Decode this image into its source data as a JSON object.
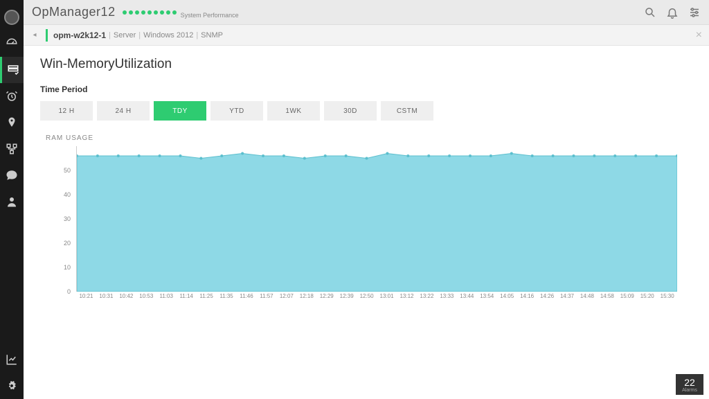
{
  "brand": "OpManager12",
  "system_perf_label": "System Performance",
  "perf_dots": 9,
  "breadcrumb": {
    "host": "opm-w2k12-1",
    "items": [
      "Server",
      "Windows 2012",
      "SNMP"
    ]
  },
  "page_title": "Win-MemoryUtilization",
  "time_period": {
    "label": "Time Period",
    "buttons": [
      "12 H",
      "24 H",
      "TDY",
      "YTD",
      "1WK",
      "30D",
      "CSTM"
    ],
    "active": "TDY"
  },
  "chart_data": {
    "type": "area",
    "title": "RAM USAGE",
    "ylabel": "",
    "xlabel": "",
    "ylim": [
      0,
      60
    ],
    "yticks": [
      0,
      10,
      20,
      30,
      40,
      50
    ],
    "categories": [
      "10:21",
      "10:31",
      "10:42",
      "10:53",
      "11:03",
      "11:14",
      "11:25",
      "11:35",
      "11:46",
      "11:57",
      "12:07",
      "12:18",
      "12:29",
      "12:39",
      "12:50",
      "13:01",
      "13:12",
      "13:22",
      "13:33",
      "13:44",
      "13:54",
      "14:05",
      "14:16",
      "14:26",
      "14:37",
      "14:48",
      "14:58",
      "15:09",
      "15:20",
      "15:30"
    ],
    "values": [
      56,
      56,
      56,
      56,
      56,
      56,
      55,
      56,
      57,
      56,
      56,
      55,
      56,
      56,
      55,
      57,
      56,
      56,
      56,
      56,
      56,
      57,
      56,
      56,
      56,
      56,
      56,
      56,
      56,
      56
    ],
    "fill_color": "#8ed9e6",
    "line_color": "#5bbfce"
  },
  "alarms": {
    "count": "22",
    "label": "Alarms"
  }
}
